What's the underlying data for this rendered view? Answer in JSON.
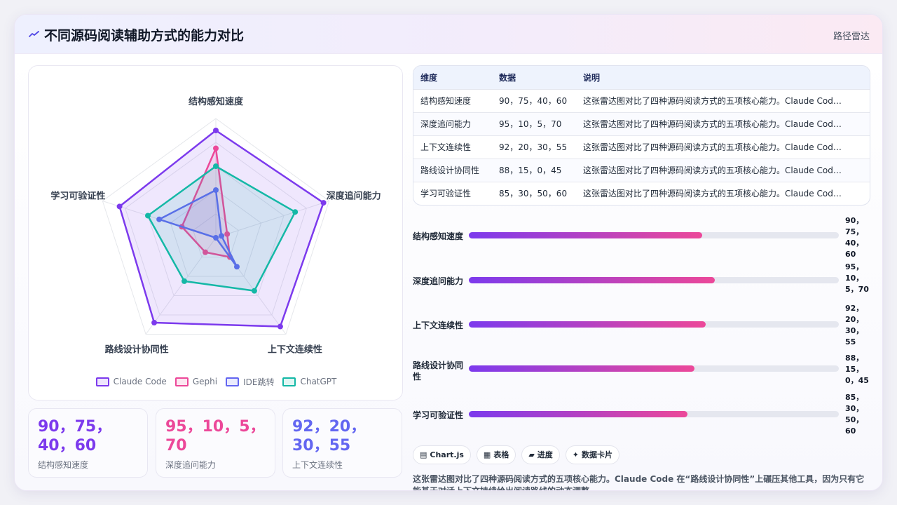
{
  "header": {
    "title": "不同源码阅读辅助方式的能力对比",
    "tag": "路径雷达"
  },
  "chart_data": {
    "type": "radar",
    "axes": [
      "结构感知速度",
      "深度追问能力",
      "上下文连续性",
      "路线设计协同性",
      "学习可验证性"
    ],
    "range": [
      0,
      100
    ],
    "series": [
      {
        "name": "Claude Code",
        "color": "#7c3aed",
        "values": [
          90,
          95,
          92,
          88,
          85
        ]
      },
      {
        "name": "Gephi",
        "color": "#ec4899",
        "values": [
          75,
          10,
          20,
          15,
          30
        ]
      },
      {
        "name": "IDE跳转",
        "color": "#6366f1",
        "values": [
          40,
          5,
          30,
          0,
          50
        ]
      },
      {
        "name": "ChatGPT",
        "color": "#14b8a6",
        "values": [
          60,
          70,
          55,
          45,
          60
        ]
      }
    ]
  },
  "table": {
    "headers": [
      "维度",
      "数据",
      "说明"
    ],
    "rows": [
      [
        "结构感知速度",
        "90，75，40，60",
        "这张雷达图对比了四种源码阅读方式的五项核心能力。Claude Cod…"
      ],
      [
        "深度追问能力",
        "95，10，5，70",
        "这张雷达图对比了四种源码阅读方式的五项核心能力。Claude Cod…"
      ],
      [
        "上下文连续性",
        "92，20，30，55",
        "这张雷达图对比了四种源码阅读方式的五项核心能力。Claude Cod…"
      ],
      [
        "路线设计协同性",
        "88，15，0，45",
        "这张雷达图对比了四种源码阅读方式的五项核心能力。Claude Cod…"
      ],
      [
        "学习可验证性",
        "85，30，50，60",
        "这张雷达图对比了四种源码阅读方式的五项核心能力。Claude Cod…"
      ]
    ]
  },
  "bars": [
    {
      "label": "结构感知速度",
      "value_text": "90，75，40，60",
      "fill": 0.63
    },
    {
      "label": "深度追问能力",
      "value_text": "95，10，5，70",
      "fill": 0.665
    },
    {
      "label": "上下文连续性",
      "value_text": "92，20，30，55",
      "fill": 0.64
    },
    {
      "label": "路线设计协同性",
      "value_text": "88，15，0，45",
      "fill": 0.61
    },
    {
      "label": "学习可验证性",
      "value_text": "85，30，50，60",
      "fill": 0.59
    }
  ],
  "kpis": [
    {
      "value": "90，75，40，60",
      "label": "结构感知速度",
      "color": "#7c3aed"
    },
    {
      "value": "95，10，5，70",
      "label": "深度追问能力",
      "color": "#ec4899"
    },
    {
      "value": "92，20，30，55",
      "label": "上下文连续性",
      "color": "#6366f1"
    }
  ],
  "chips": [
    {
      "icon": "chart-icon",
      "label": "Chart.js"
    },
    {
      "icon": "table-icon",
      "label": "表格"
    },
    {
      "icon": "progress-icon",
      "label": "进度"
    },
    {
      "icon": "sparkle-icon",
      "label": "数据卡片"
    }
  ],
  "summary": "这张雷达图对比了四种源码阅读方式的五项核心能力。Claude Code 在“路线设计协同性”上碾压其他工具，因为只有它能基于对话上下文持续给出阅读路线的动态调整。"
}
